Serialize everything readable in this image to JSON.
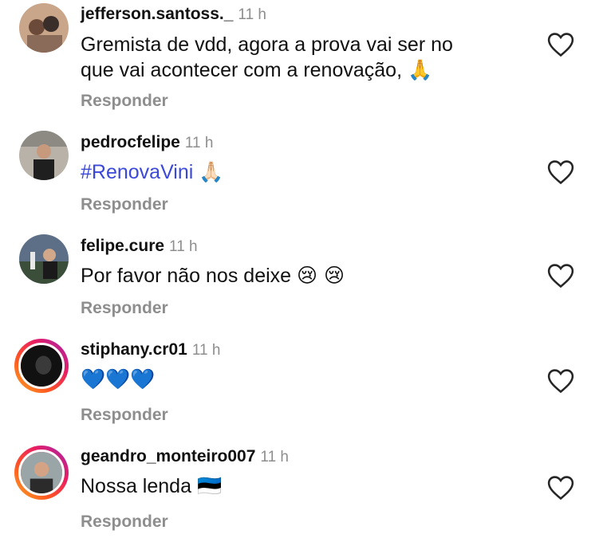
{
  "comments": [
    {
      "username": "jefferson.santoss._",
      "time": "11 h",
      "text_line1": "Gremista de vdd, agora a prova vai ser no",
      "text_line2": "que vai acontecer com a renovação,",
      "emoji": "🙏",
      "reply": "Responder"
    },
    {
      "username": "pedrocfelipe",
      "time": "11 h",
      "text": "#RenovaVini",
      "emoji": "🙏🏻",
      "reply": "Responder"
    },
    {
      "username": "felipe.cure",
      "time": "11 h",
      "text": "Por favor não nos deixe",
      "emoji": "😢 😢",
      "reply": "Responder"
    },
    {
      "username": "stiphany.cr01",
      "time": "11 h",
      "text": "💙💙💙",
      "reply": "Responder"
    },
    {
      "username": "geandro_monteiro007",
      "time": "11 h",
      "text": "Nossa lenda",
      "emoji": "🇪🇪",
      "reply": "Responder"
    }
  ],
  "icons": {
    "like": "heart-outline-icon"
  },
  "colors": {
    "hashtag": "#3b48d9",
    "muted": "#8e8e8e"
  }
}
